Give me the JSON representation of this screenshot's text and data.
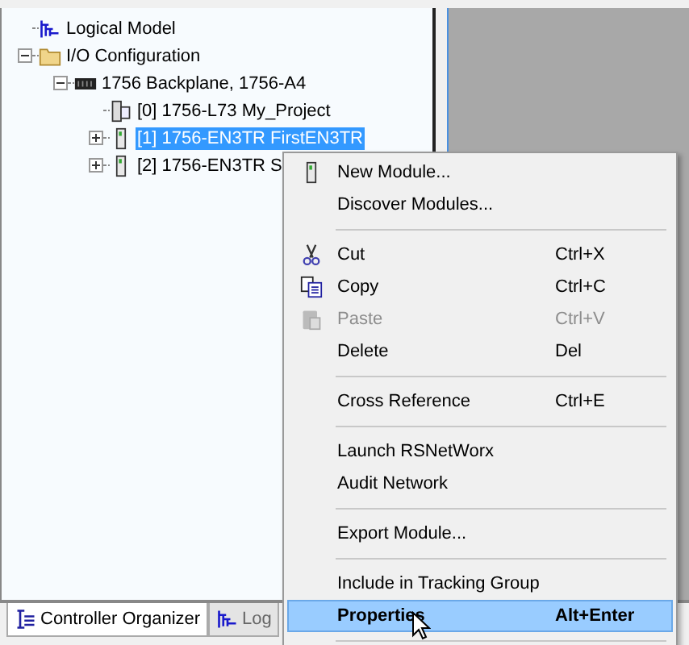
{
  "tree": [
    {
      "label": "Logical Model",
      "kind": "model",
      "selected": false
    },
    {
      "label": "I/O Configuration",
      "kind": "folder",
      "selected": false,
      "expanded": true,
      "children": [
        {
          "label": "1756 Backplane, 1756-A4",
          "kind": "backplane",
          "selected": false,
          "expanded": true,
          "children": [
            {
              "label": "[0] 1756-L73 My_Project",
              "kind": "controller",
              "selected": false
            },
            {
              "label": "[1] 1756-EN3TR FirstEN3TR",
              "kind": "module",
              "selected": true,
              "expanded": false
            },
            {
              "label": "[2] 1756-EN3TR S",
              "kind": "module",
              "selected": false,
              "expanded": false
            }
          ]
        }
      ]
    }
  ],
  "context_menu": {
    "groups": [
      [
        {
          "label": "New Module...",
          "kind": "module",
          "selected": false,
          "disabled": false
        },
        {
          "label": "Discover Modules...",
          "kind": "plain",
          "selected": false,
          "disabled": false
        }
      ],
      [
        {
          "label": "Cut",
          "shortcut": "Ctrl+X",
          "kind": "cut",
          "selected": false,
          "disabled": false
        },
        {
          "label": "Copy",
          "shortcut": "Ctrl+C",
          "kind": "copy",
          "selected": false,
          "disabled": false
        },
        {
          "label": "Paste",
          "shortcut": "Ctrl+V",
          "kind": "paste",
          "selected": false,
          "disabled": true
        },
        {
          "label": "Delete",
          "shortcut": "Del",
          "kind": "plain",
          "selected": false,
          "disabled": false
        }
      ],
      [
        {
          "label": "Cross Reference",
          "shortcut": "Ctrl+E",
          "kind": "plain",
          "selected": false,
          "disabled": false
        }
      ],
      [
        {
          "label": "Launch RSNetWorx",
          "kind": "plain",
          "selected": false,
          "disabled": false
        },
        {
          "label": "Audit Network",
          "kind": "plain",
          "selected": false,
          "disabled": false
        }
      ],
      [
        {
          "label": "Export Module...",
          "kind": "plain",
          "selected": false,
          "disabled": false
        }
      ],
      [
        {
          "label": "Include in Tracking Group",
          "kind": "plain",
          "selected": false,
          "disabled": false
        },
        {
          "label": "Properties",
          "shortcut": "Alt+Enter",
          "kind": "plain",
          "selected": true,
          "disabled": false
        }
      ]
    ]
  },
  "tabs": [
    {
      "label": "Controller Organizer",
      "kind": "organizer",
      "selected": true
    },
    {
      "label": "Log",
      "kind": "model",
      "selected": false
    }
  ]
}
